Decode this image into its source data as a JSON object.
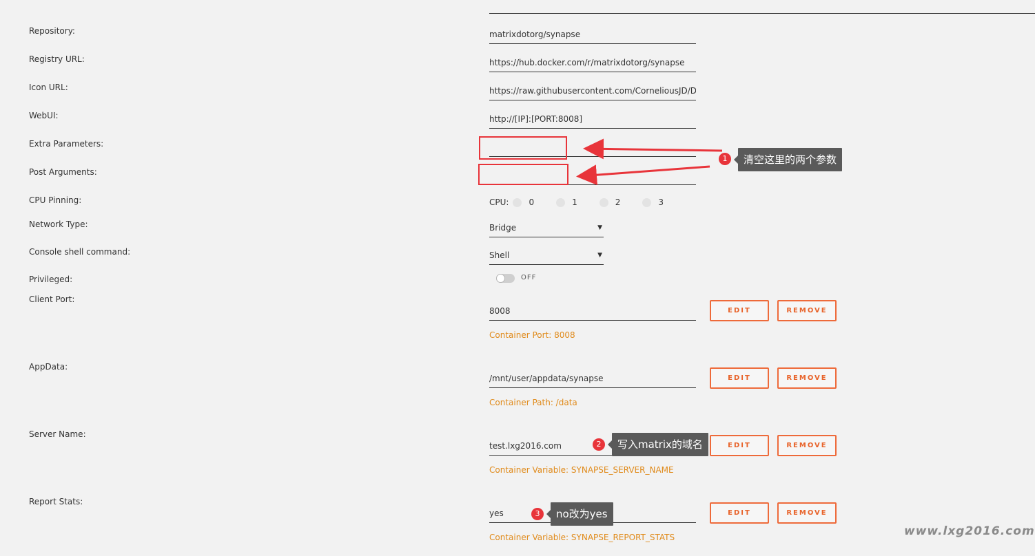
{
  "form": {
    "repository": {
      "label": "Repository:",
      "value": "matrixdotorg/synapse"
    },
    "registry_url": {
      "label": "Registry URL:",
      "value": "https://hub.docker.com/r/matrixdotorg/synapse"
    },
    "icon_url": {
      "label": "Icon URL:",
      "value": "https://raw.githubusercontent.com/CorneliousJD/D"
    },
    "webui": {
      "label": "WebUI:",
      "value": "http://[IP]:[PORT:8008]"
    },
    "extra_parameters": {
      "label": "Extra Parameters:",
      "value": ""
    },
    "post_arguments": {
      "label": "Post Arguments:",
      "value": ""
    },
    "cpu_pinning": {
      "label": "CPU Pinning:",
      "cpu_label": "CPU:",
      "options": [
        "0",
        "1",
        "2",
        "3"
      ]
    },
    "network_type": {
      "label": "Network Type:",
      "value": "Bridge"
    },
    "console_shell": {
      "label": "Console shell command:",
      "value": "Shell"
    },
    "privileged": {
      "label": "Privileged:",
      "state": "OFF"
    },
    "client_port": {
      "label": "Client Port:",
      "value": "8008",
      "hint": "Container Port: 8008"
    },
    "appdata": {
      "label": "AppData:",
      "value": "/mnt/user/appdata/synapse",
      "hint": "Container Path: /data"
    },
    "server_name": {
      "label": "Server Name:",
      "value": "test.lxg2016.com",
      "hint": "Container Variable: SYNAPSE_SERVER_NAME"
    },
    "report_stats": {
      "label": "Report Stats:",
      "value": "yes",
      "hint": "Container Variable: SYNAPSE_REPORT_STATS"
    }
  },
  "buttons": {
    "edit": "EDIT",
    "remove": "REMOVE"
  },
  "annotations": [
    {
      "number": "1",
      "text": "清空这里的两个参数"
    },
    {
      "number": "2",
      "text": "写入matrix的域名"
    },
    {
      "number": "3",
      "text": "no改为yes"
    }
  ],
  "colors": {
    "accent": "#ee6a3a",
    "hint": "#e08a1a",
    "annotation_red": "#e8343a",
    "tooltip_bg": "#5a5a5a",
    "background": "#f2f2f2"
  },
  "watermark": "www.lxg2016.com"
}
